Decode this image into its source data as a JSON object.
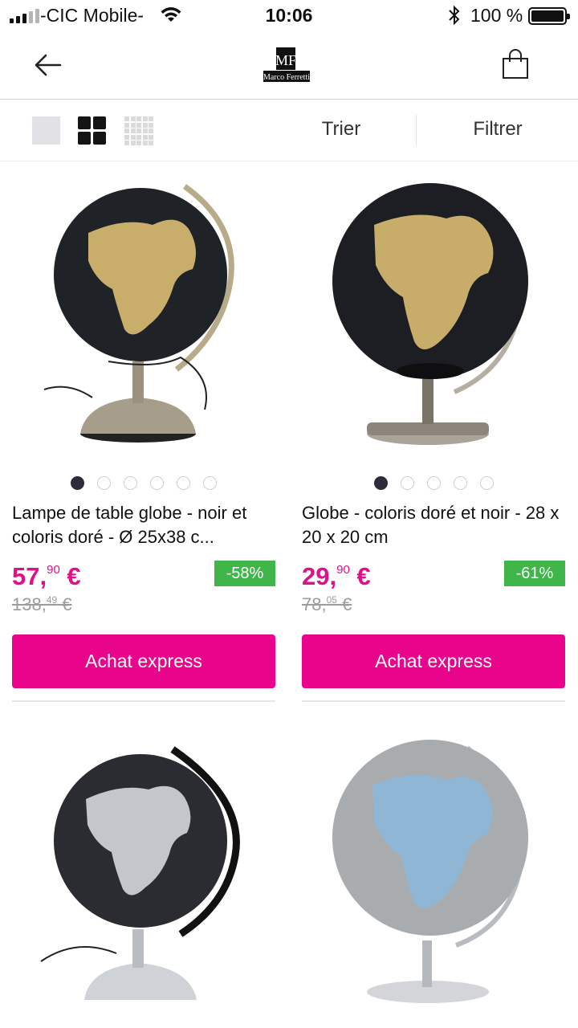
{
  "status_bar": {
    "carrier": "-CIC Mobile-",
    "time": "10:06",
    "battery": "100 %"
  },
  "header": {
    "back_icon": "arrow-left-icon",
    "logo_alt": "Marco Ferretti",
    "cart_icon": "shopping-bag-icon"
  },
  "toolbar": {
    "sort_label": "Trier",
    "filter_label": "Filtrer",
    "view_icons": [
      "single-view-icon",
      "grid-2-view-icon",
      "grid-3-view-icon"
    ]
  },
  "products": [
    {
      "title": "Lampe de table globe - noir et coloris doré - Ø 25x38 c...",
      "price_int": "57,",
      "price_dec": "90",
      "price_cur": " €",
      "old_int": "138,",
      "old_dec": "49",
      "old_cur": " €",
      "discount": "-58%",
      "button": "Achat express",
      "dots": 6
    },
    {
      "title": "Globe - coloris doré et noir -  28 x 20 x 20 cm",
      "price_int": "29,",
      "price_dec": "90",
      "price_cur": " €",
      "old_int": "78,",
      "old_dec": "05",
      "old_cur": " €",
      "discount": "-61%",
      "button": "Achat express",
      "dots": 5
    }
  ],
  "colors": {
    "accent": "#e8048b",
    "price": "#e0108a",
    "discount": "#40b54a"
  }
}
